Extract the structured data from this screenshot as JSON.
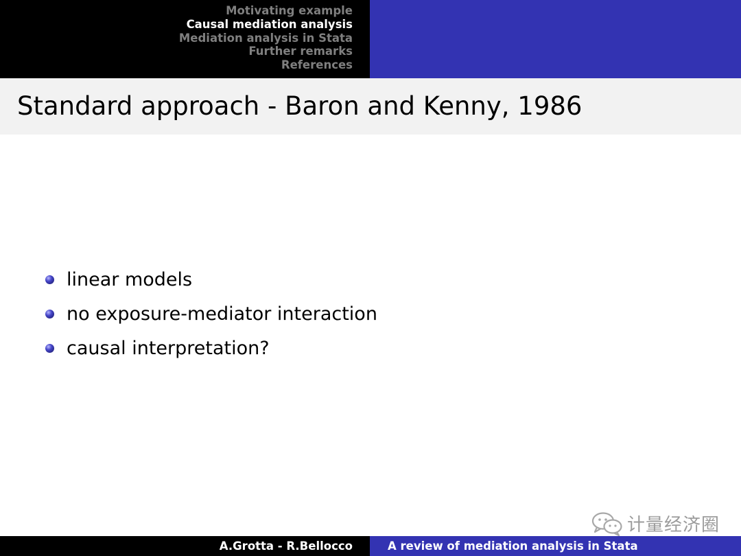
{
  "header": {
    "sections": [
      {
        "label": "Motivating example",
        "active": false
      },
      {
        "label": "Causal mediation analysis",
        "active": true
      },
      {
        "label": "Mediation analysis in Stata",
        "active": false
      },
      {
        "label": "Further remarks",
        "active": false
      },
      {
        "label": "References",
        "active": false
      }
    ]
  },
  "slide": {
    "title": "Standard approach - Baron and Kenny, 1986",
    "bullets": [
      "linear models",
      "no exposure-mediator interaction",
      "causal interpretation?"
    ]
  },
  "watermark": {
    "icon": "wechat-icon",
    "text": "计量经济圈"
  },
  "footer": {
    "authors": "A.Grotta - R.Bellocco",
    "talk_title": "A review of mediation analysis in Stata"
  },
  "colors": {
    "header_left": "#000000",
    "header_right": "#3333b2",
    "title_bar": "#f2f2f2",
    "nav_inactive": "#7f7f7f",
    "nav_active": "#ffffff"
  }
}
